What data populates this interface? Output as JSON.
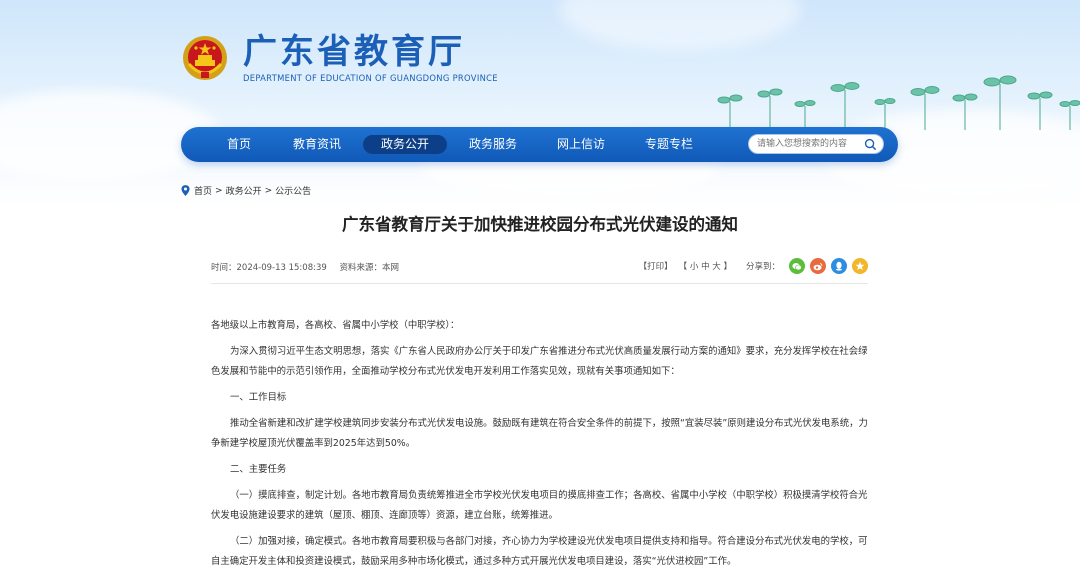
{
  "site": {
    "name_cn": "广东省教育厅",
    "name_en": "DEPARTMENT OF EDUCATION OF GUANGDONG PROVINCE"
  },
  "nav": {
    "items": [
      {
        "label": "首页"
      },
      {
        "label": "教育资讯"
      },
      {
        "label": "政务公开"
      },
      {
        "label": "政务服务"
      },
      {
        "label": "网上信访"
      },
      {
        "label": "专题专栏"
      }
    ],
    "active": "政务公开",
    "search_placeholder": "请输入您想搜索的内容"
  },
  "breadcrumb": {
    "home": "首页",
    "level1": "政务公开",
    "level2": "公示公告",
    "separator": ">"
  },
  "article": {
    "title": "广东省教育厅关于加快推进校园分布式光伏建设的通知",
    "time": "时间：2024-09-13 15:08:39",
    "source": "资料来源：本网",
    "print": "【打印】",
    "font_size": "【 小  中  大 】",
    "share_label": "分享到：",
    "share_icons": [
      "wechat-icon",
      "weibo-icon",
      "qq-icon",
      "qzone-icon"
    ],
    "paragraphs": {
      "salutation": "各地级以上市教育局，各高校、省属中小学校（中职学校）：",
      "intro": "为深入贯彻习近平生态文明思想，落实《广东省人民政府办公厅关于印发广东省推进分布式光伏高质量发展行动方案的通知》要求，充分发挥学校在社会绿色发展和节能中的示范引领作用，全面推动学校分布式光伏发电开发利用工作落实见效，现就有关事项通知如下：",
      "h1": "一、工作目标",
      "p1": "推动全省新建和改扩建学校建筑同步安装分布式光伏发电设施。鼓励既有建筑在符合安全条件的前提下，按照“宜装尽装”原则建设分布式光伏发电系统，力争新建学校屋顶光伏覆盖率到2025年达到50%。",
      "h2": "二、主要任务",
      "p2": "（一）摸底排查，制定计划。各地市教育局负责统筹推进全市学校光伏发电项目的摸底排查工作；各高校、省属中小学校（中职学校）积极摸清学校符合光伏发电设施建设要求的建筑（屋顶、棚顶、连廊顶等）资源，建立台账，统筹推进。",
      "p3": "（二）加强对接，确定模式。各地市教育局要积极与各部门对接，齐心协力为学校建设光伏发电项目提供支持和指导。符合建设分布式光伏发电的学校，可自主确定开发主体和投资建设模式，鼓励采用多种市场化模式，通过多种方式开展光伏发电项目建设，落实“光伏进校园”工作。"
    }
  },
  "colors": {
    "brand_blue": "#1b5fb6",
    "nav_blue": "#1565c4",
    "nav_active": "#0d3f88"
  }
}
